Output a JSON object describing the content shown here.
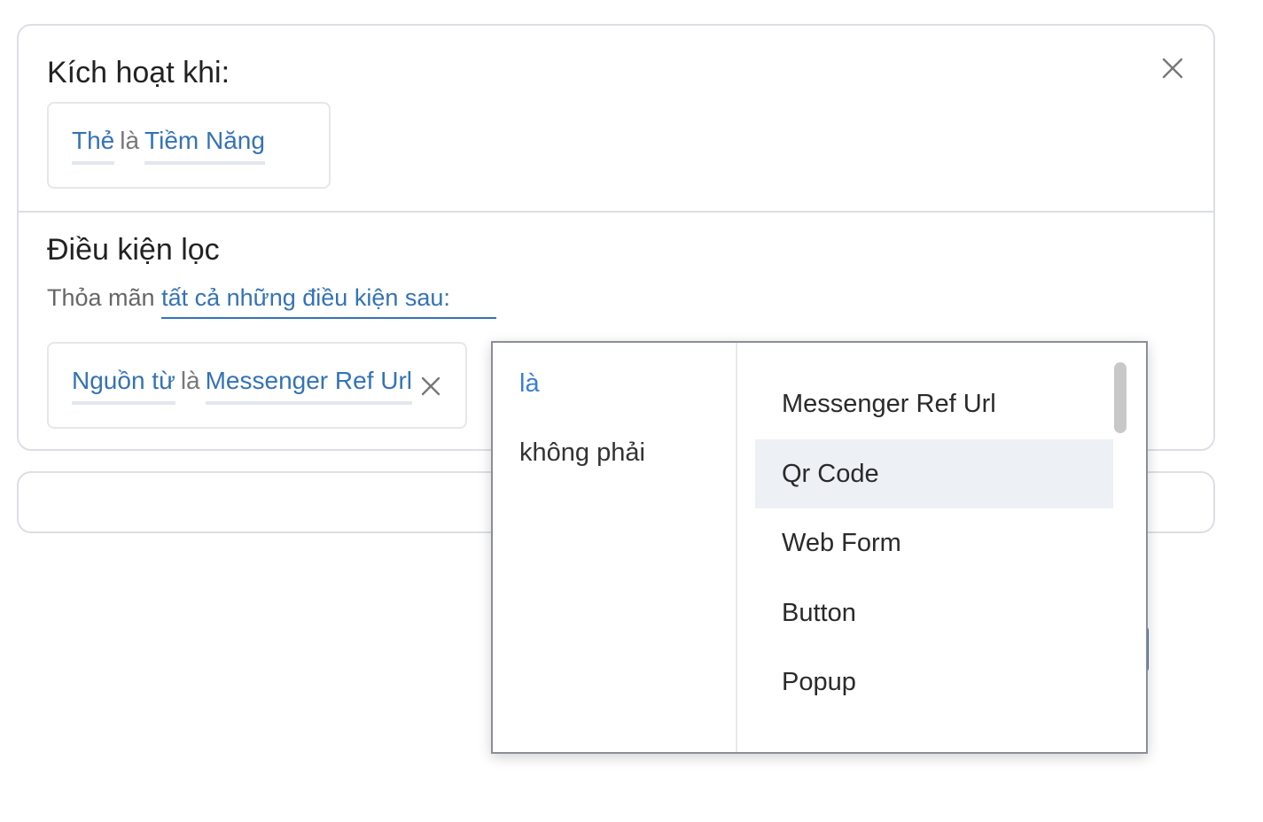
{
  "trigger": {
    "title": "Kích hoạt khi:",
    "condition": {
      "field": "Thẻ",
      "operator": "là",
      "value": "Tiềm Năng"
    }
  },
  "filter": {
    "title": "Điều kiện lọc",
    "match_prefix": "Thỏa mãn",
    "match_mode": "tất cả những điều kiện sau:",
    "condition": {
      "field": "Nguồn từ",
      "operator": "là",
      "value": "Messenger Ref Url"
    }
  },
  "dropdown": {
    "operators": [
      {
        "label": "là",
        "selected": true
      },
      {
        "label": "không phải",
        "selected": false
      }
    ],
    "values": [
      {
        "label": "Messenger Ref Url"
      },
      {
        "label": "Qr Code",
        "hovered": true
      },
      {
        "label": "Web Form"
      },
      {
        "label": "Button"
      },
      {
        "label": "Popup"
      }
    ]
  },
  "colors": {
    "link": "#3473b5",
    "active_operator": "#3a7fd0",
    "hover_bg": "#edf0f4",
    "border": "#dcdfe4"
  },
  "icons": {
    "close": "close-icon",
    "remove_condition": "close-icon"
  }
}
